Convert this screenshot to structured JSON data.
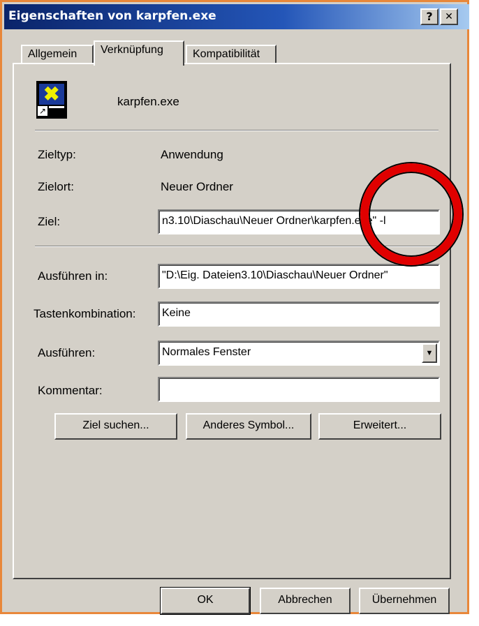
{
  "window": {
    "title": "Eigenschaften von karpfen.exe",
    "help_button": "?",
    "close_button": "✕"
  },
  "tabs": [
    {
      "label": "Allgemein",
      "active": false
    },
    {
      "label": "Verknüpfung",
      "active": true
    },
    {
      "label": "Kompatibilität",
      "active": false
    }
  ],
  "shortcut": {
    "name": "karpfen.exe",
    "rows": {
      "zieltyp": {
        "label": "Zieltyp:",
        "value": "Anwendung"
      },
      "zielort": {
        "label": "Zielort:",
        "value": "Neuer Ordner"
      },
      "ziel": {
        "label": "Ziel:",
        "value": "n3.10\\Diaschau\\Neuer Ordner\\karpfen.exe\" -l"
      }
    },
    "ausfuehren_in": {
      "label": "Ausführen in:",
      "value": "\"D:\\Eig. Dateien3.10\\Diaschau\\Neuer Ordner\""
    },
    "tastenkombination": {
      "label": "Tastenkombination:",
      "value": "Keine"
    },
    "ausfuehren": {
      "label": "Ausführen:",
      "value": "Normales Fenster"
    },
    "kommentar": {
      "label": "Kommentar:",
      "value": ""
    }
  },
  "actions": {
    "ziel_suchen": "Ziel suchen...",
    "anderes_symbol": "Anderes Symbol...",
    "erweitert": "Erweitert..."
  },
  "footer": {
    "ok": "OK",
    "abbrechen": "Abbrechen",
    "uebernehmen": "Übernehmen"
  },
  "colors": {
    "annotation_circle": "#e00000",
    "frame_border": "#e8873a",
    "titlebar_start": "#0a246a",
    "dialog_bg": "#d4d0c8"
  }
}
